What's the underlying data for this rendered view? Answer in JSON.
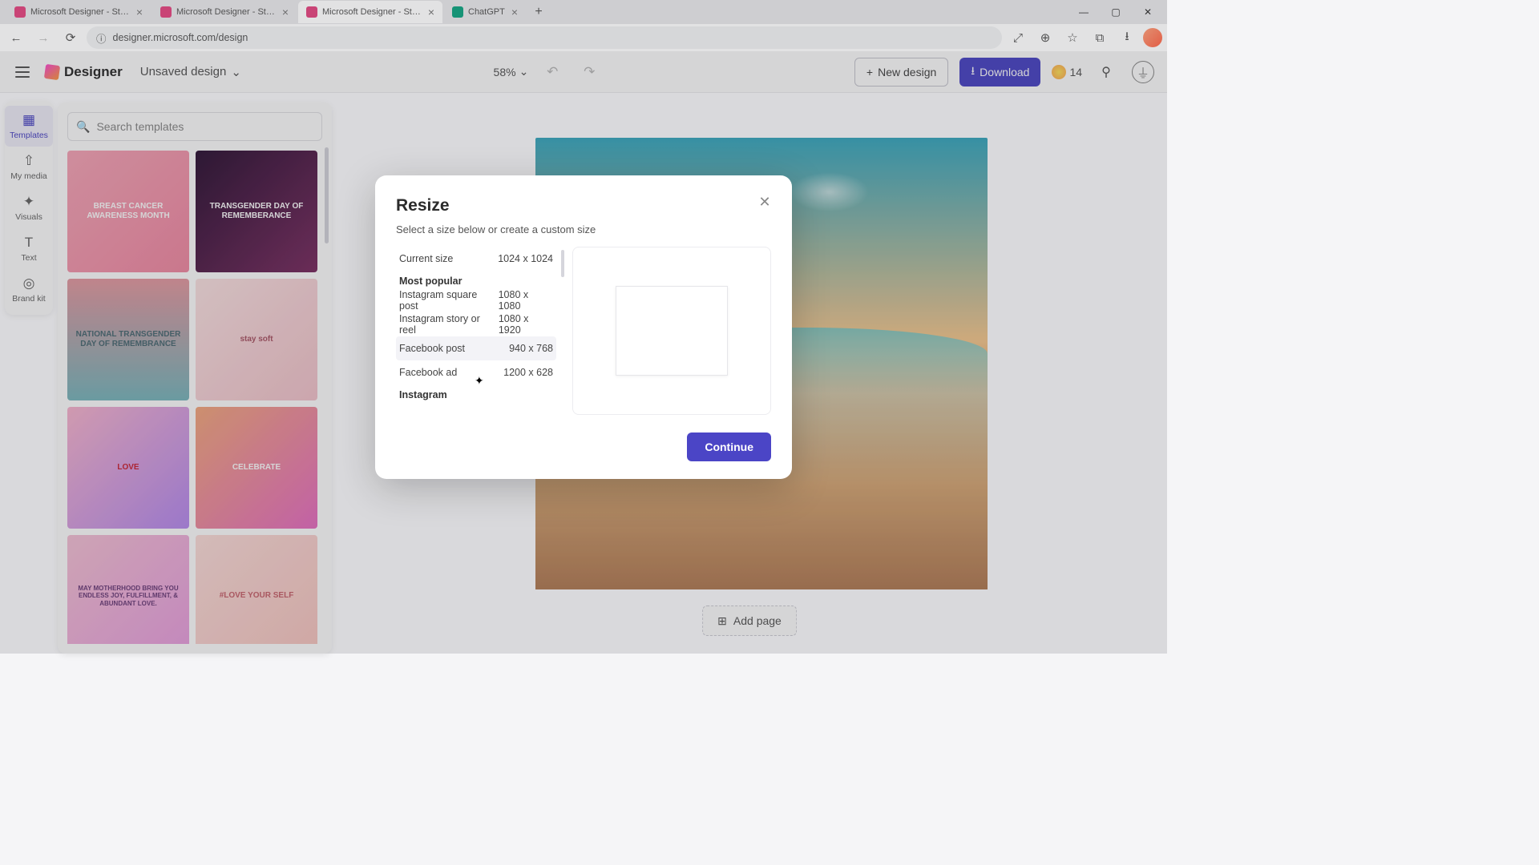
{
  "browser": {
    "tabs": [
      {
        "title": "Microsoft Designer - Stunning",
        "favicon": "#e2467f"
      },
      {
        "title": "Microsoft Designer - Stunning",
        "favicon": "#e2467f"
      },
      {
        "title": "Microsoft Designer - Stunning",
        "favicon": "#e2467f",
        "active": true
      },
      {
        "title": "ChatGPT",
        "favicon": "#10a37f"
      }
    ],
    "url": "designer.microsoft.com/design"
  },
  "header": {
    "app_name": "Designer",
    "doc_name": "Unsaved design",
    "zoom": "58%",
    "new_design": "New design",
    "download": "Download",
    "credits": "14"
  },
  "rail": {
    "items": [
      {
        "label": "Templates",
        "icon": "▦"
      },
      {
        "label": "My media",
        "icon": "⇧"
      },
      {
        "label": "Visuals",
        "icon": "✦"
      },
      {
        "label": "Text",
        "icon": "T"
      },
      {
        "label": "Brand kit",
        "icon": "◎"
      }
    ]
  },
  "templates": {
    "search_placeholder": "Search templates",
    "thumbs": [
      {
        "label": "BREAST CANCER AWARENESS MONTH",
        "bg": "linear-gradient(135deg,#f7a6b8,#f28aa4)"
      },
      {
        "label": "TRANSGENDER DAY OF REMEMBERANCE",
        "bg": "linear-gradient(135deg,#2d1335,#7b2d62)"
      },
      {
        "label": "NATIONAL TRANSGENDER DAY OF REMEMBRANCE",
        "bg": "linear-gradient(180deg,#e59aa2,#7ab7bd)"
      },
      {
        "label": "stay soft",
        "bg": "linear-gradient(135deg,#fbe3e3,#f4c4cc)"
      },
      {
        "label": "LOVE",
        "bg": "linear-gradient(135deg,#f9b6d0,#b78bf0)"
      },
      {
        "label": "CELEBRATE",
        "bg": "linear-gradient(135deg,#f4a97e,#e86fc3)"
      },
      {
        "label": "MAY MOTHERHOOD BRING YOU ENDLESS JOY, FULFILLMENT, & ABUNDANT LOVE.",
        "bg": "linear-gradient(135deg,#f6c2d6,#e99fe0)"
      },
      {
        "label": "#LOVE YOUR SELF",
        "bg": "linear-gradient(135deg,#fddedb,#f8c6c1)"
      }
    ]
  },
  "canvas": {
    "add_page": "Add page"
  },
  "modal": {
    "title": "Resize",
    "subtitle": "Select a size below or create a custom size",
    "current_label": "Current size",
    "current_value": "1024 x 1024",
    "heading_popular": "Most popular",
    "sizes": [
      {
        "name": "Instagram square post",
        "dim": "1080 x 1080"
      },
      {
        "name": "Instagram story or reel",
        "dim": "1080 x 1920"
      },
      {
        "name": "Facebook post",
        "dim": "940 x 768"
      },
      {
        "name": "Facebook ad",
        "dim": "1200 x 628"
      }
    ],
    "heading_instagram": "Instagram",
    "continue": "Continue"
  }
}
